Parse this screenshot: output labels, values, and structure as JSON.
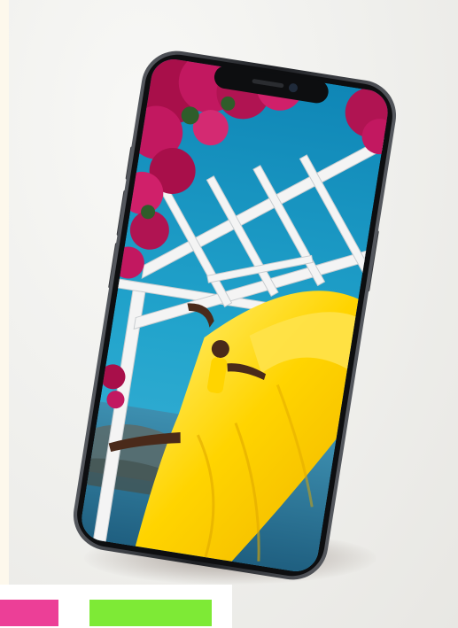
{
  "image": {
    "subject": "phone-mockup",
    "colors": {
      "background": "#efefec",
      "phone_frame": "#2a2c30",
      "sky": "#1a9bc4",
      "dress": "#ffd400",
      "flowers": "#b8124f",
      "pergola": "#f2f2f2",
      "swatch_pink": "#ec3f97",
      "swatch_green": "#7eea36"
    }
  }
}
